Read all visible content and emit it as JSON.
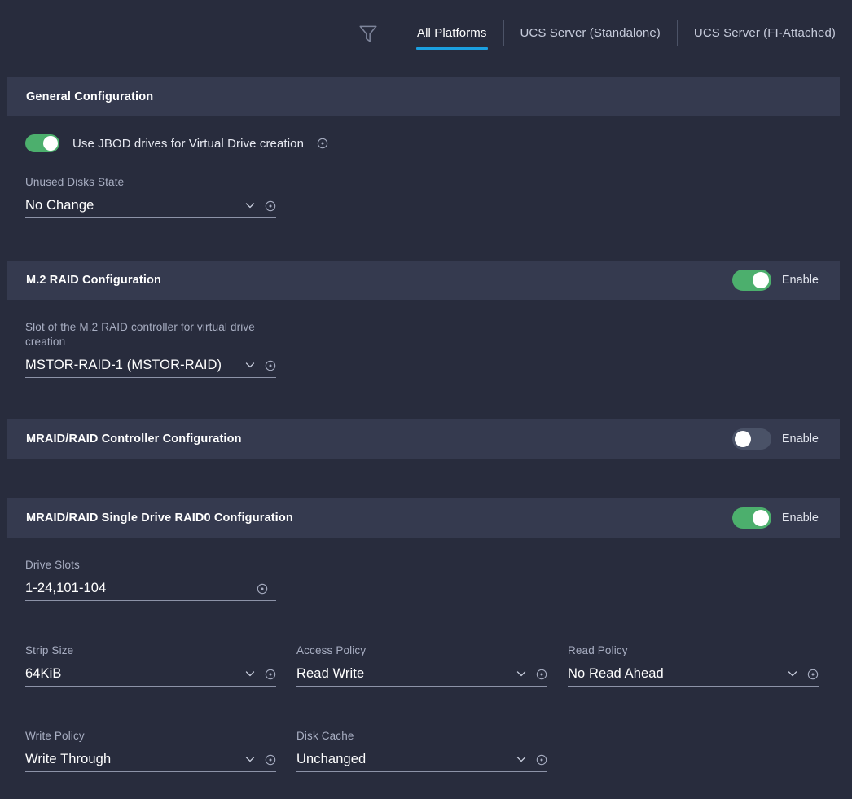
{
  "topbar": {
    "filter_icon": "filter-funnel-icon",
    "tabs": [
      {
        "label": "All Platforms",
        "active": true
      },
      {
        "label": "UCS Server (Standalone)",
        "active": false
      },
      {
        "label": "UCS Server (FI-Attached)",
        "active": false
      }
    ]
  },
  "colors": {
    "background": "#282c3d",
    "section_header": "#353a4f",
    "accent_blue": "#1ba0e1",
    "toggle_on": "#4caf6d",
    "toggle_off": "#4a5267",
    "label": "#a8aec2",
    "value": "#ffffff",
    "underline": "#8d93a8"
  },
  "sections": {
    "general": {
      "title": "General Configuration",
      "jbod_toggle": {
        "label": "Use JBOD drives for Virtual Drive creation",
        "state": "on",
        "info_icon": "info-icon"
      },
      "unused_disks_state": {
        "label": "Unused Disks State",
        "value": "No Change",
        "chevron_icon": "chevron-down-icon",
        "info_icon": "info-icon"
      }
    },
    "m2raid": {
      "title": "M.2 RAID Configuration",
      "enable_label": "Enable",
      "enable_state": "on",
      "slot": {
        "label": "Slot of the M.2 RAID controller for virtual drive creation",
        "value": "MSTOR-RAID-1 (MSTOR-RAID)",
        "chevron_icon": "chevron-down-icon",
        "info_icon": "info-icon"
      }
    },
    "mraid_controller": {
      "title": "MRAID/RAID Controller Configuration",
      "enable_label": "Enable",
      "enable_state": "off"
    },
    "mraid_raid0": {
      "title": "MRAID/RAID Single Drive RAID0 Configuration",
      "enable_label": "Enable",
      "enable_state": "on",
      "drive_slots": {
        "label": "Drive Slots",
        "value": "1-24,101-104",
        "info_icon": "info-icon"
      },
      "strip_size": {
        "label": "Strip Size",
        "value": "64KiB",
        "chevron_icon": "chevron-down-icon",
        "info_icon": "info-icon"
      },
      "access_policy": {
        "label": "Access Policy",
        "value": "Read Write",
        "chevron_icon": "chevron-down-icon",
        "info_icon": "info-icon"
      },
      "read_policy": {
        "label": "Read Policy",
        "value": "No Read Ahead",
        "chevron_icon": "chevron-down-icon",
        "info_icon": "info-icon"
      },
      "write_policy": {
        "label": "Write Policy",
        "value": "Write Through",
        "chevron_icon": "chevron-down-icon",
        "info_icon": "info-icon"
      },
      "disk_cache": {
        "label": "Disk Cache",
        "value": "Unchanged",
        "chevron_icon": "chevron-down-icon",
        "info_icon": "info-icon"
      }
    }
  }
}
